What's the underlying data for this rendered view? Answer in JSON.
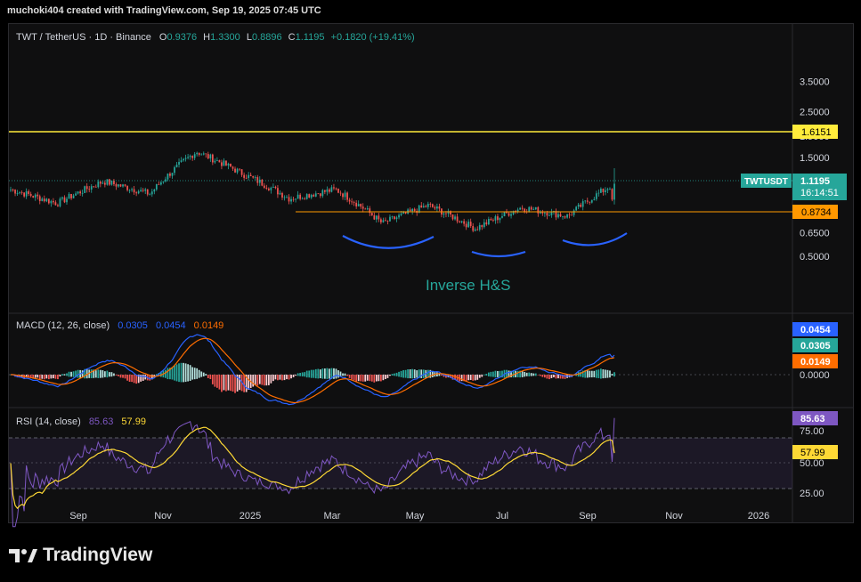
{
  "header": {
    "attribution": "muchoki404 created with TradingView.com, Sep 19, 2025 07:45 UTC"
  },
  "main_pane": {
    "symbol_line": "TWT / TetherUS · 1D · Binance",
    "ohlc": {
      "o_label": "O",
      "o": "0.9376",
      "h_label": "H",
      "h": "1.3300",
      "l_label": "L",
      "l": "0.8896",
      "c_label": "C",
      "c": "1.1195",
      "change": "+0.1820 (+19.41%)"
    },
    "annotation": "Inverse H&S",
    "price_label": {
      "symbol": "TWTUSDT",
      "price": "1.1195",
      "countdown": "16:14:51"
    },
    "lines": {
      "yellow_level": "1.6151",
      "orange_level": "0.8734"
    }
  },
  "macd_pane": {
    "title": "MACD (12, 26, close)",
    "v1": "0.0305",
    "v2": "0.0454",
    "v3": "0.0149",
    "badges": [
      "0.0454",
      "0.0305",
      "0.0149"
    ]
  },
  "rsi_pane": {
    "title": "RSI (14, close)",
    "rsi": "85.63",
    "ma": "57.99"
  },
  "footer": {
    "brand": "TradingView"
  },
  "colors": {
    "up": "#26a69a",
    "down": "#ef5350",
    "yellow": "#ffeb3b",
    "orange": "#ff9800",
    "macd": "#2962ff",
    "signal": "#ff6d00",
    "rsi": "#7e57c2",
    "rsi_ma": "#fdd835",
    "annotation": "#26a69a",
    "neckline": "#2962ff"
  },
  "chart_data": [
    {
      "type": "candlestick",
      "title": "TWT / TetherUS · 1D · Binance",
      "x_ticks": [
        "Sep",
        "Nov",
        "2025",
        "Mar",
        "May",
        "Jul",
        "Sep",
        "Nov",
        "2026"
      ],
      "y_ticks": [
        "3.5000",
        "2.5000",
        "1.9000",
        "1.5000",
        "0.8000",
        "0.6500",
        "0.5000"
      ],
      "y_scale": "log",
      "ylim": [
        0.43,
        3.6
      ],
      "approx_close_path": [
        {
          "month": "Aug 2024",
          "close": 1.05
        },
        {
          "month": "Sep 2024",
          "close": 0.9
        },
        {
          "month": "Oct 2024",
          "close": 1.15
        },
        {
          "month": "Nov 2024",
          "close": 1.0
        },
        {
          "month": "early Dec 2024",
          "close": 1.6
        },
        {
          "month": "Jan 2025",
          "close": 1.25
        },
        {
          "month": "Feb 2025",
          "close": 0.95
        },
        {
          "month": "Mar 2025",
          "close": 1.05
        },
        {
          "month": "Apr 2025",
          "close": 0.72
        },
        {
          "month": "May 2025",
          "close": 0.88
        },
        {
          "month": "Jun 2025",
          "close": 0.68
        },
        {
          "month": "Jul 2025",
          "close": 0.86
        },
        {
          "month": "Aug 2025",
          "close": 0.78
        },
        {
          "month": "Sep 2025",
          "close": 1.1195
        }
      ],
      "last_candle": {
        "open": 0.9376,
        "high": 1.33,
        "low": 0.8896,
        "close": 1.1195
      },
      "horizontal_lines": [
        1.6151,
        0.8734
      ]
    },
    {
      "type": "line",
      "title": "MACD (12, 26, close)",
      "y_ticks": [
        "0.0000"
      ],
      "series": [
        {
          "name": "MACD",
          "last": 0.0454
        },
        {
          "name": "Signal",
          "last": 0.0305
        },
        {
          "name": "Histogram",
          "last": 0.0149
        }
      ]
    },
    {
      "type": "line",
      "title": "RSI (14, close)",
      "y_ticks": [
        "75.00",
        "50.00",
        "25.00"
      ],
      "ylim": [
        15,
        95
      ],
      "series": [
        {
          "name": "RSI",
          "last": 85.63
        },
        {
          "name": "RSI MA",
          "last": 57.99
        }
      ]
    }
  ]
}
